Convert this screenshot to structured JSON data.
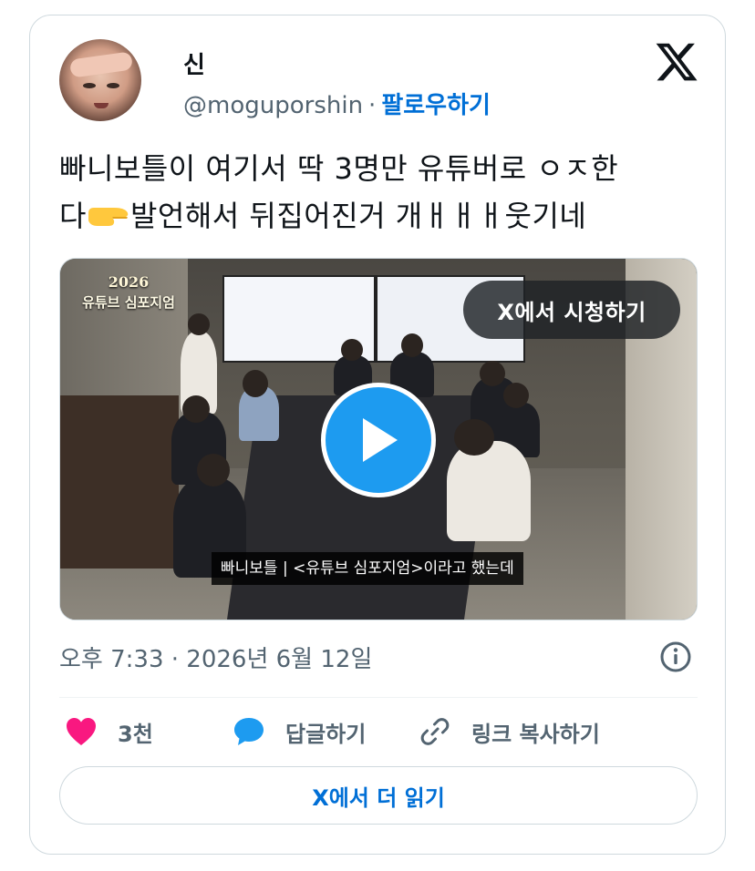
{
  "author": {
    "display_name": "신",
    "handle": "@moguporshin",
    "separator": "·",
    "follow_label": "팔로우하기"
  },
  "platform_icon": "x-logo-icon",
  "tweet": {
    "text_line1": "빠니보틀이 여기서 딱 3명만 유튜버로 ㅇㅈ한",
    "text_line2_a": "다",
    "text_line2_emoji": "backhand-index-pointing-right-emoji",
    "text_line2_b": "발언해서 뒤집어진거 개ㅐㅐㅐ웃기네"
  },
  "media": {
    "badge_year": "2026",
    "badge_title": "유튜브 심포지엄",
    "watch_label": "X에서 시청하기",
    "caption": "빠니보틀 | <유튜브 심포지엄>이라고 했는데",
    "play_icon": "play-icon"
  },
  "meta": {
    "timestamp": "오후 7:33 · 2026년 6월 12일"
  },
  "actions": {
    "like_count": "3천",
    "reply_label": "답글하기",
    "copy_link_label": "링크 복사하기"
  },
  "read_more_label": "X에서 더 읽기",
  "colors": {
    "accent": "#006fd6",
    "like": "#f91880",
    "play": "#1d9bf0",
    "muted": "#536471",
    "border": "#cfd9de"
  }
}
